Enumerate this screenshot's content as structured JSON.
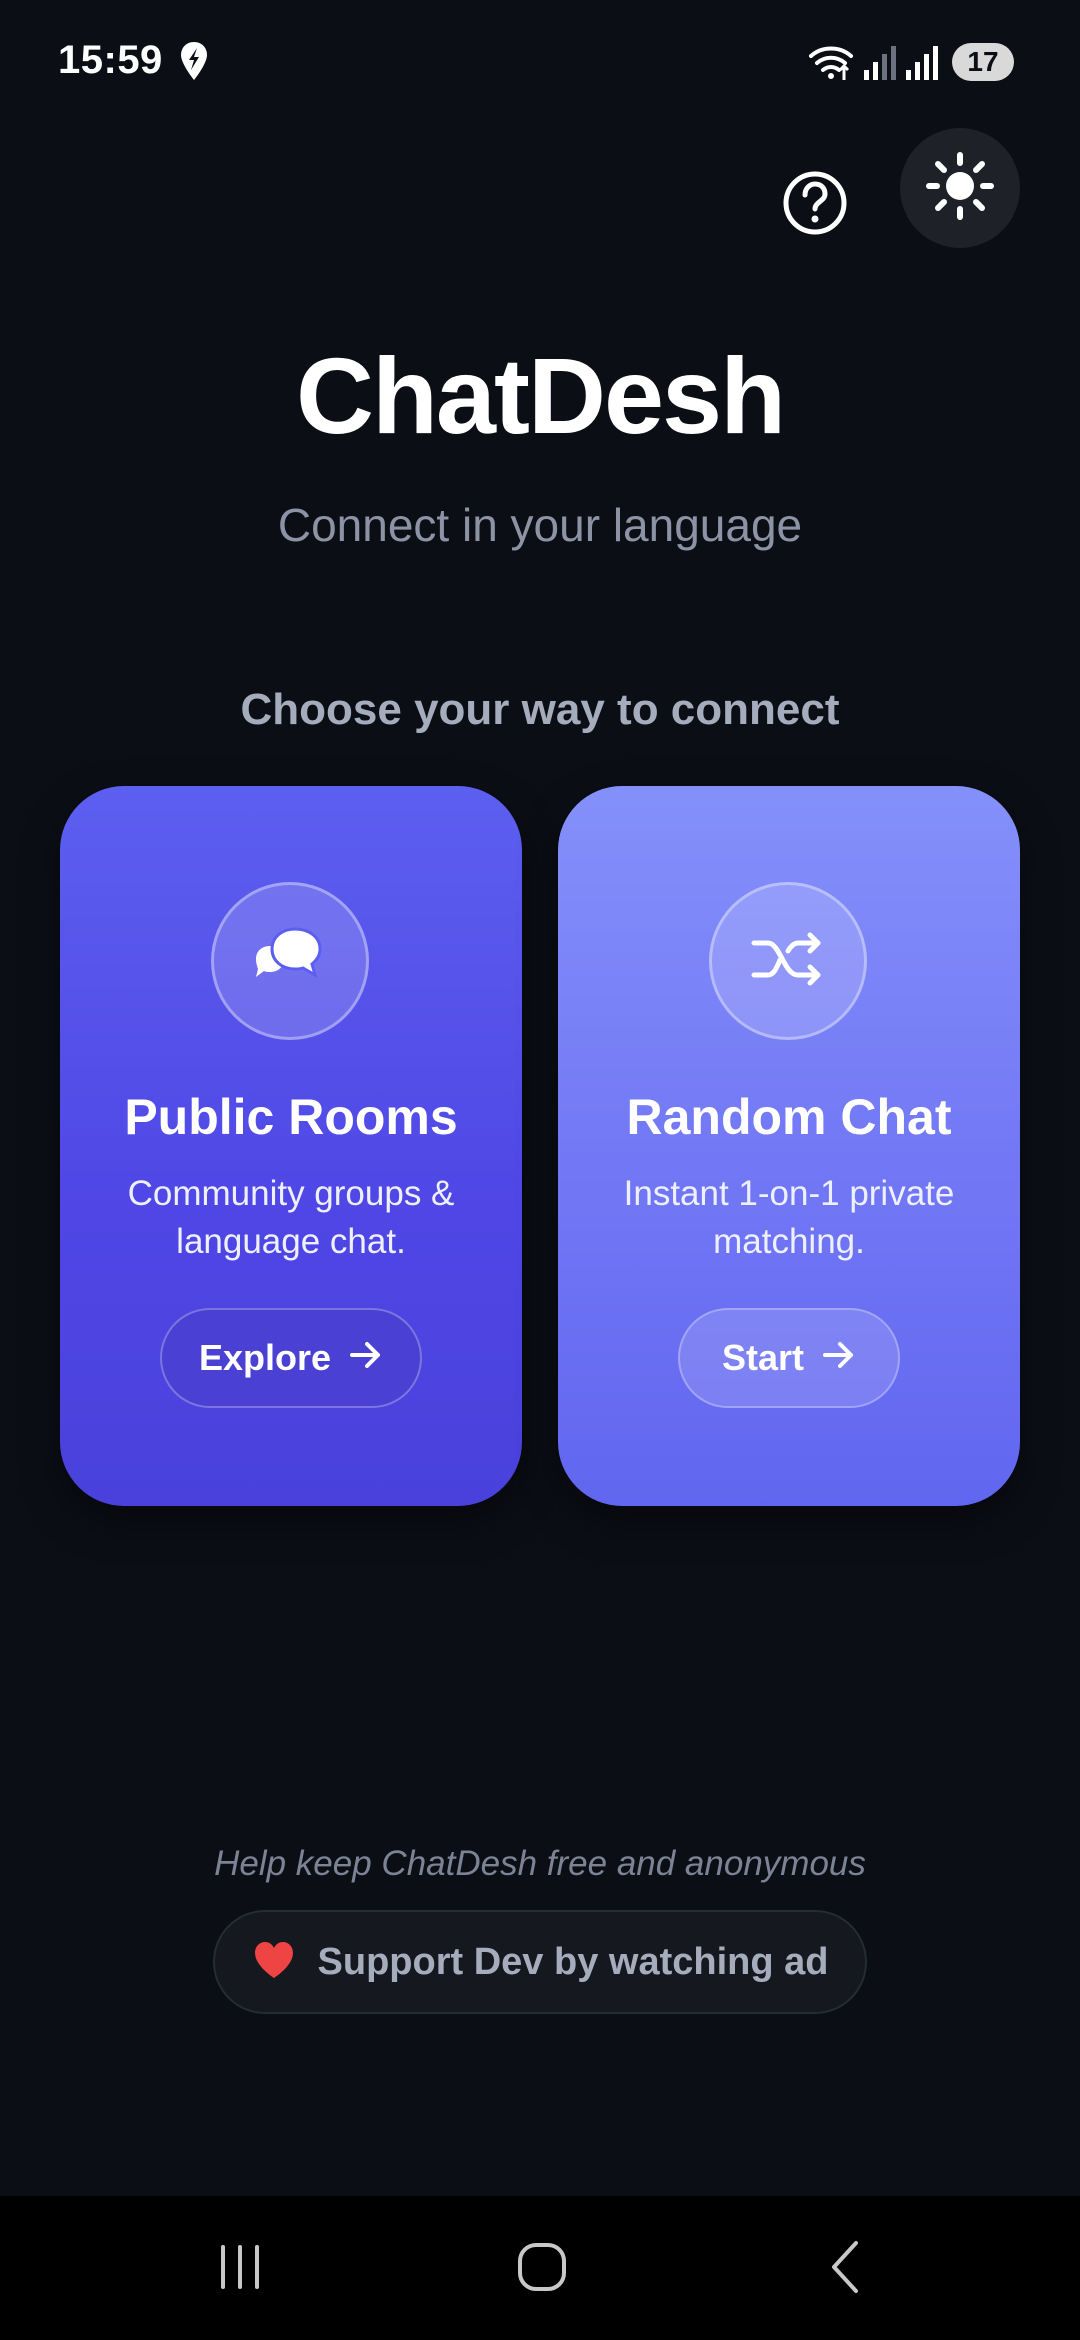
{
  "status_bar": {
    "time": "15:59",
    "battery": "17"
  },
  "header": {
    "title": "ChatDesh",
    "tagline": "Connect in your language"
  },
  "main": {
    "section_heading": "Choose your way to connect",
    "cards": [
      {
        "title": "Public Rooms",
        "description": "Community groups & language chat.",
        "button_label": "Explore",
        "icon": "chat-bubbles-icon"
      },
      {
        "title": "Random Chat",
        "description": "Instant 1-on-1 private matching.",
        "button_label": "Start",
        "icon": "shuffle-icon"
      }
    ]
  },
  "footer": {
    "support_note": "Help keep ChatDesh free and anonymous",
    "support_button_label": "Support Dev by watching ad",
    "support_icon": "heart-icon"
  },
  "colors": {
    "background": "#0b0e15",
    "public_card": "#4f46e5",
    "random_card": "#7379f5",
    "heart": "#ef4444",
    "muted_text": "#8b93a5"
  }
}
